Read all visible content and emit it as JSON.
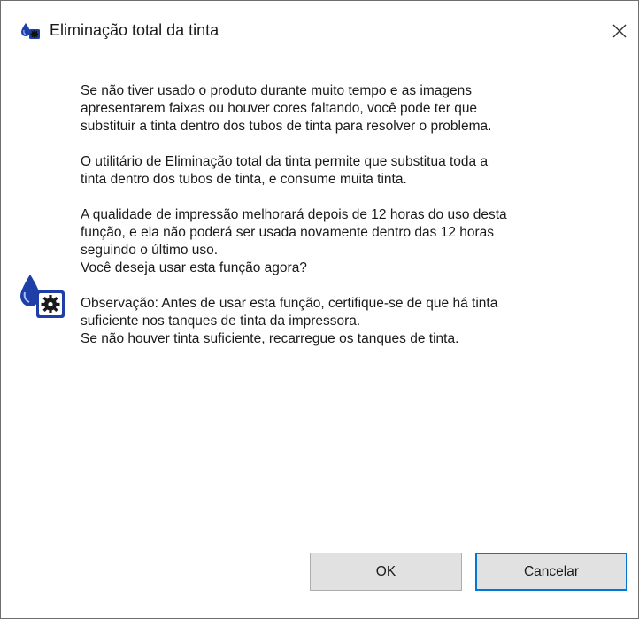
{
  "window": {
    "title": "Eliminação total da tinta",
    "icon": "ink-drop-gear-icon",
    "close_icon": "close-icon",
    "close_symbol": "×"
  },
  "message": {
    "paragraphs": [
      {
        "lines": [
          "Se não tiver usado o produto durante muito tempo e as imagens",
          "apresentarem faixas ou houver cores faltando, você pode ter que",
          "substituir a tinta dentro dos tubos de tinta para resolver o problema."
        ]
      },
      {
        "lines": [
          "O utilitário de Eliminação total da tinta permite que substitua toda a",
          "tinta dentro dos tubos de tinta, e consume muita tinta."
        ]
      },
      {
        "lines": [
          "A qualidade de impressão melhorará depois de 12 horas do uso desta",
          "função, e ela não poderá ser usada novamente dentro das 12 horas",
          "seguindo o último uso.",
          "Você deseja usar esta função agora?"
        ]
      },
      {
        "lines": [
          "Observação: Antes de usar esta função, certifique-se de que há tinta",
          "suficiente nos tanques de tinta da impressora.",
          "Se não houver tinta suficiente, recarregue os tanques de tinta."
        ]
      }
    ]
  },
  "buttons": {
    "ok_label": "OK",
    "cancel_label": "Cancelar"
  },
  "colors": {
    "focus_border": "#0078d7",
    "button_face": "#e1e1e1",
    "ink_blue": "#1f3fa8",
    "gear_dark": "#1a1a1a"
  }
}
